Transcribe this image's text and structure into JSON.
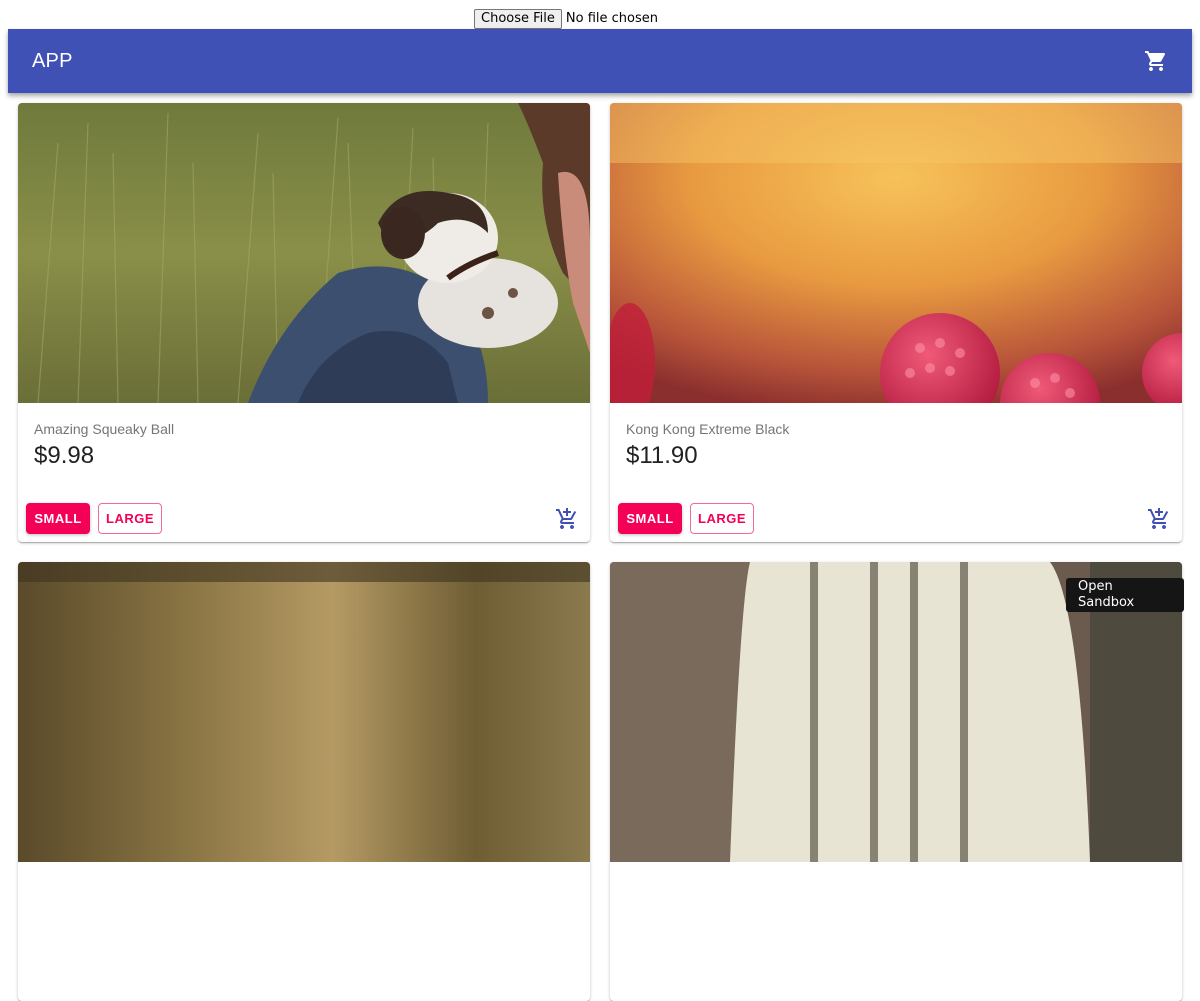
{
  "file_input": {
    "button_label": "Choose File",
    "status": "No file chosen"
  },
  "appbar": {
    "title": "APP",
    "cart_icon": "shopping-cart-icon",
    "color": "#3f51b5"
  },
  "products": [
    {
      "name": "Amazing Squeaky Ball",
      "price": "$9.98",
      "image": "dog-in-grass-photo",
      "small_label": "SMALL",
      "large_label": "LARGE",
      "add_icon": "add-shopping-cart-icon"
    },
    {
      "name": "Kong Kong Extreme Black",
      "price": "$11.90",
      "image": "raspberries-photo",
      "small_label": "SMALL",
      "large_label": "LARGE",
      "add_icon": "add-shopping-cart-icon"
    },
    {
      "image": "outdoor-blurred-photo"
    },
    {
      "image": "striped-knit-photo"
    }
  ],
  "accent_color": "#f50057",
  "tooltip": {
    "text": "Open Sandbox"
  }
}
